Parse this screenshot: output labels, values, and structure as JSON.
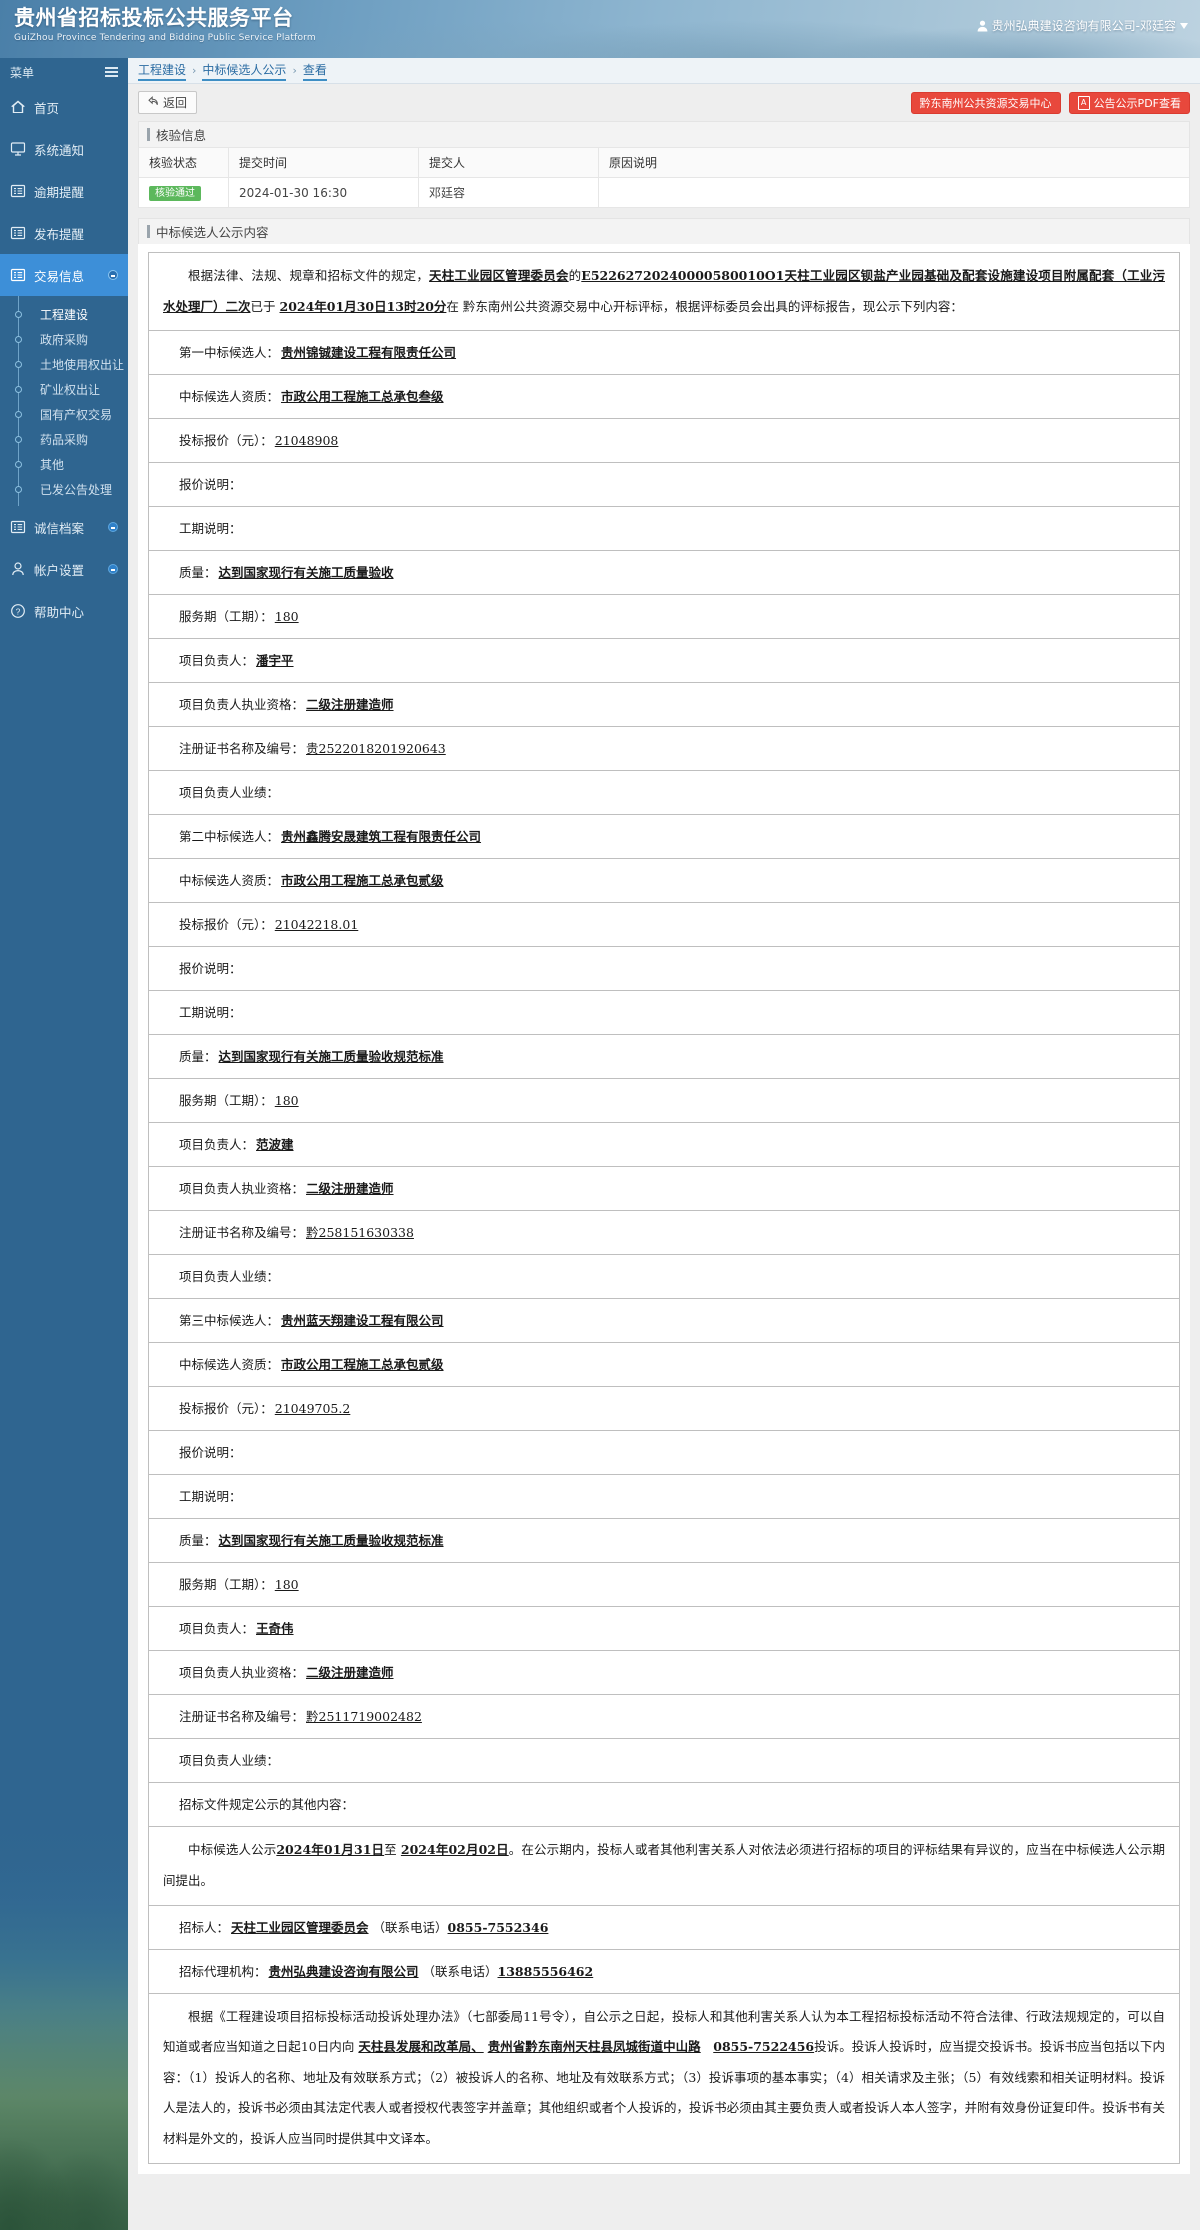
{
  "header": {
    "title_cn": "贵州省招标投标公共服务平台",
    "title_en": "GuiZhou Province Tendering and Bidding Public Service Platform",
    "user": "贵州弘典建设咨询有限公司-邓廷容"
  },
  "sidebar": {
    "menu_label": "菜单",
    "items": [
      {
        "label": "首页",
        "icon": "home-icon"
      },
      {
        "label": "系统通知",
        "icon": "monitor-icon"
      },
      {
        "label": "逾期提醒",
        "icon": "list-icon"
      },
      {
        "label": "发布提醒",
        "icon": "list-icon"
      },
      {
        "label": "交易信息",
        "icon": "list-icon"
      }
    ],
    "sub_items": [
      {
        "label": "工程建设"
      },
      {
        "label": "政府采购"
      },
      {
        "label": "土地使用权出让"
      },
      {
        "label": "矿业权出让"
      },
      {
        "label": "国有产权交易"
      },
      {
        "label": "药品采购"
      },
      {
        "label": "其他"
      },
      {
        "label": "已发公告处理"
      }
    ],
    "bottom_items": [
      {
        "label": "诚信档案",
        "icon": "archive-icon"
      },
      {
        "label": "帐户设置",
        "icon": "user-icon"
      },
      {
        "label": "帮助中心",
        "icon": "question-icon"
      }
    ]
  },
  "breadcrumb": {
    "items": [
      "工程建设",
      "中标候选人公示",
      "查看"
    ],
    "separator": "›"
  },
  "toolbar": {
    "back_label": "返回",
    "center_button": "黔东南州公共资源交易中心",
    "pdf_button": "公告公示PDF查看",
    "pdf_icon_glyph": "A"
  },
  "verify_panel": {
    "title": "核验信息",
    "columns": [
      "核验状态",
      "提交时间",
      "提交人",
      "原因说明"
    ],
    "rows": [
      {
        "status": "核验通过",
        "time": "2024-01-30 16:30",
        "submitter": "邓廷容",
        "reason": ""
      }
    ]
  },
  "notice_panel": {
    "title": "中标候选人公示内容"
  },
  "notice": {
    "intro": {
      "lead": "根据法律、法规、规章和招标文件的规定，",
      "tenderee": "天柱工业园区管理委员会",
      "of": "的",
      "project_no_name": "E52262720240000580010O1天柱工业园区钡盐产业园基础及配套设施建设项目附属配套（工业污水处理厂）二次",
      "mid1": "已于",
      "open_time": "2024年01月30日13时20分",
      "mid2": "在",
      "place": "黔东南州公共资源交易中心开标评标，根据评标委员会出具的评标报告，现公示下列内容："
    },
    "candidates": [
      {
        "rank_label": "第一中标候选人：",
        "rank_value": "贵州锦铖建设工程有限责任公司",
        "rows": [
          {
            "label": "中标候选人资质：",
            "value": "市政公用工程施工总承包叁级"
          },
          {
            "label": "投标报价（元）：",
            "value": "21048908"
          },
          {
            "label": "报价说明：",
            "value": ""
          },
          {
            "label": "工期说明：",
            "value": ""
          },
          {
            "label": "质量：",
            "value": "达到国家现行有关施工质量验收"
          },
          {
            "label": "服务期（工期）：",
            "value": "180"
          },
          {
            "label": "项目负责人：",
            "value": "潘宇平"
          },
          {
            "label": "项目负责人执业资格：",
            "value": "二级注册建造师"
          },
          {
            "label": "注册证书名称及编号：",
            "value": "贵2522018201920643"
          },
          {
            "label": "项目负责人业绩：",
            "value": ""
          }
        ]
      },
      {
        "rank_label": "第二中标候选人：",
        "rank_value": "贵州鑫腾安晟建筑工程有限责任公司",
        "rows": [
          {
            "label": "中标候选人资质：",
            "value": "市政公用工程施工总承包贰级"
          },
          {
            "label": "投标报价（元）：",
            "value": "21042218.01"
          },
          {
            "label": "报价说明：",
            "value": ""
          },
          {
            "label": "工期说明：",
            "value": ""
          },
          {
            "label": "质量：",
            "value": "达到国家现行有关施工质量验收规范标准"
          },
          {
            "label": "服务期（工期）：",
            "value": "180"
          },
          {
            "label": "项目负责人：",
            "value": "范波建"
          },
          {
            "label": "项目负责人执业资格：",
            "value": "二级注册建造师"
          },
          {
            "label": "注册证书名称及编号：",
            "value": "黔258151630338"
          },
          {
            "label": "项目负责人业绩：",
            "value": ""
          }
        ]
      },
      {
        "rank_label": "第三中标候选人：",
        "rank_value": "贵州蓝天翔建设工程有限公司",
        "rows": [
          {
            "label": "中标候选人资质：",
            "value": "市政公用工程施工总承包贰级"
          },
          {
            "label": "投标报价（元）：",
            "value": "21049705.2"
          },
          {
            "label": "报价说明：",
            "value": ""
          },
          {
            "label": "工期说明：",
            "value": ""
          },
          {
            "label": "质量：",
            "value": "达到国家现行有关施工质量验收规范标准"
          },
          {
            "label": "服务期（工期）：",
            "value": "180"
          },
          {
            "label": "项目负责人：",
            "value": "王奇伟"
          },
          {
            "label": "项目负责人执业资格：",
            "value": "二级注册建造师"
          },
          {
            "label": "注册证书名称及编号：",
            "value": "黔2511719002482"
          },
          {
            "label": "项目负责人业绩：",
            "value": ""
          }
        ]
      }
    ],
    "other_content_label": "招标文件规定公示的其他内容：",
    "publicity": {
      "p1": "中标候选人公示",
      "date_from": "2024年01月31日",
      "to": "至",
      "date_to": "2024年02月02日",
      "p2": "。在公示期内，投标人或者其他利害关系人对依法必须进行招标的项目的评标结果有异议的，应当在中标候选人公示期间提出。"
    },
    "tenderee_row": {
      "label": "招标人：",
      "name": "天柱工业园区管理委员会",
      "phone_label": "（联系电话）",
      "phone": "0855-7552346"
    },
    "agency_row": {
      "label": "招标代理机构：",
      "name": "贵州弘典建设咨询有限公司",
      "phone_label": "（联系电话）",
      "phone": "13885556462"
    },
    "complaint": {
      "t1": "根据《工程建设项目招标投标活动投诉处理办法》（七部委局11号令），自公示之日起，投标人和其他利害关系人认为本工程招标投标活动不符合法律、行政法规规定的，可以自知道或者应当知道之日起10日内向",
      "org1": "天柱县发展和改革局、",
      "org2": "贵州省黔东南州天柱县凤城街道中山路",
      "phone": "0855-7522456",
      "t2": "投诉。投诉人投诉时，应当提交投诉书。投诉书应当包括以下内容：（1）投诉人的名称、地址及有效联系方式；（2）被投诉人的名称、地址及有效联系方式；（3）投诉事项的基本事实；（4）相关请求及主张；（5）有效线索和相关证明材料。投诉人是法人的，投诉书必须由其法定代表人或者授权代表签字并盖章；其他组织或者个人投诉的，投诉书必须由其主要负责人或者投诉人本人签字，并附有效身份证复印件。投诉书有关材料是外文的，投诉人应当同时提供其中文译本。"
    }
  },
  "colors": {
    "brand_blue": "#2f6590",
    "accent_blue": "#3d8fd8",
    "red": "#e8483c",
    "green": "#5cb85c"
  }
}
